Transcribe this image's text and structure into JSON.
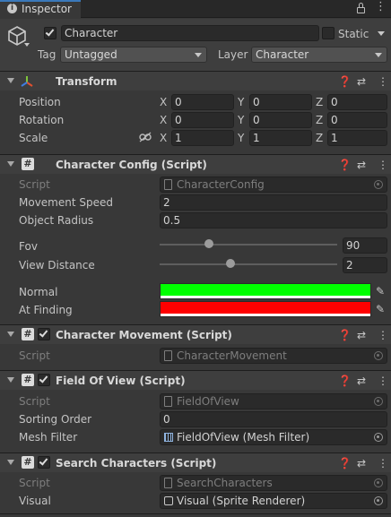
{
  "tab": {
    "title": "Inspector",
    "icon": "info-icon"
  },
  "go": {
    "name": "Character",
    "static_label": "Static",
    "tag_label": "Tag",
    "tag_value": "Untagged",
    "layer_label": "Layer",
    "layer_value": "Character"
  },
  "transform": {
    "title": "Transform",
    "position_label": "Position",
    "rotation_label": "Rotation",
    "scale_label": "Scale",
    "x": "X",
    "y": "Y",
    "z": "Z",
    "position": [
      "0",
      "0",
      "0"
    ],
    "rotation": [
      "0",
      "0",
      "0"
    ],
    "scale": [
      "1",
      "1",
      "1"
    ]
  },
  "config": {
    "title": "Character Config (Script)",
    "script_label": "Script",
    "script_value": "CharacterConfig",
    "move_label": "Movement Speed",
    "move_value": "2",
    "radius_label": "Object Radius",
    "radius_value": "0.5",
    "fov_label": "Fov",
    "fov_value": "90",
    "fov_fraction": 0.28,
    "viewdist_label": "View Distance",
    "viewdist_value": "2",
    "viewdist_fraction": 0.4,
    "normal_label": "Normal",
    "normal_color": "#00ff00",
    "finding_label": "At Finding",
    "finding_color": "#ff0000"
  },
  "movement": {
    "title": "Character Movement (Script)",
    "script_label": "Script",
    "script_value": "CharacterMovement"
  },
  "fov": {
    "title": "Field Of View (Script)",
    "script_label": "Script",
    "script_value": "FieldOfView",
    "sorting_label": "Sorting Order",
    "sorting_value": "0",
    "mesh_label": "Mesh Filter",
    "mesh_value": "FieldOfView (Mesh Filter)"
  },
  "search": {
    "title": "Search Characters (Script)",
    "script_label": "Script",
    "script_value": "SearchCharacters",
    "visual_label": "Visual",
    "visual_value": "Visual (Sprite Renderer)"
  }
}
